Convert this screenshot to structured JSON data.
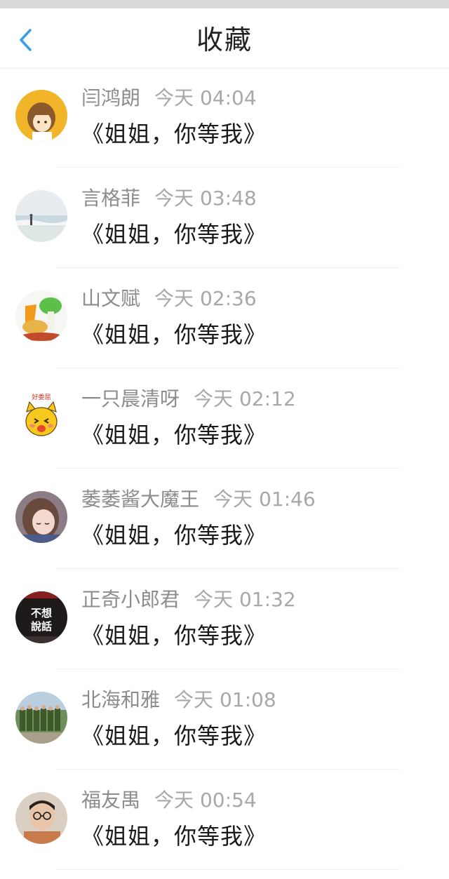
{
  "header": {
    "title": "收藏",
    "back_icon": "chevron-left-icon",
    "accent_color": "#3a9ee6"
  },
  "items": [
    {
      "name": "闫鸿朗",
      "date": "今天",
      "time": "04:04",
      "message": "《姐姐，你等我》",
      "avatar": "cartoon-girl-avatar"
    },
    {
      "name": "言格菲",
      "date": "今天",
      "time": "03:48",
      "message": "《姐姐，你等我》",
      "avatar": "beach-photo-avatar"
    },
    {
      "name": "山文赋",
      "date": "今天",
      "time": "02:36",
      "message": "《姐姐，你等我》",
      "avatar": "vegetables-avatar"
    },
    {
      "name": "一只晨清呀",
      "date": "今天",
      "time": "02:12",
      "message": "《姐姐，你等我》",
      "avatar": "yellow-cat-avatar",
      "avatar_caption": "好委屈"
    },
    {
      "name": "萎萎酱大魔王",
      "date": "今天",
      "time": "01:46",
      "message": "《姐姐，你等我》",
      "avatar": "anime-girl-avatar"
    },
    {
      "name": "正奇小郎君",
      "date": "今天",
      "time": "01:32",
      "message": "《姐姐，你等我》",
      "avatar": "text-avatar",
      "avatar_caption": "不想\n說話"
    },
    {
      "name": "北海和雅",
      "date": "今天",
      "time": "01:08",
      "message": "《姐姐，你等我》",
      "avatar": "soldiers-photo-avatar"
    },
    {
      "name": "福友禺",
      "date": "今天",
      "time": "00:54",
      "message": "《姐姐，你等我》",
      "avatar": "boy-photo-avatar"
    }
  ]
}
